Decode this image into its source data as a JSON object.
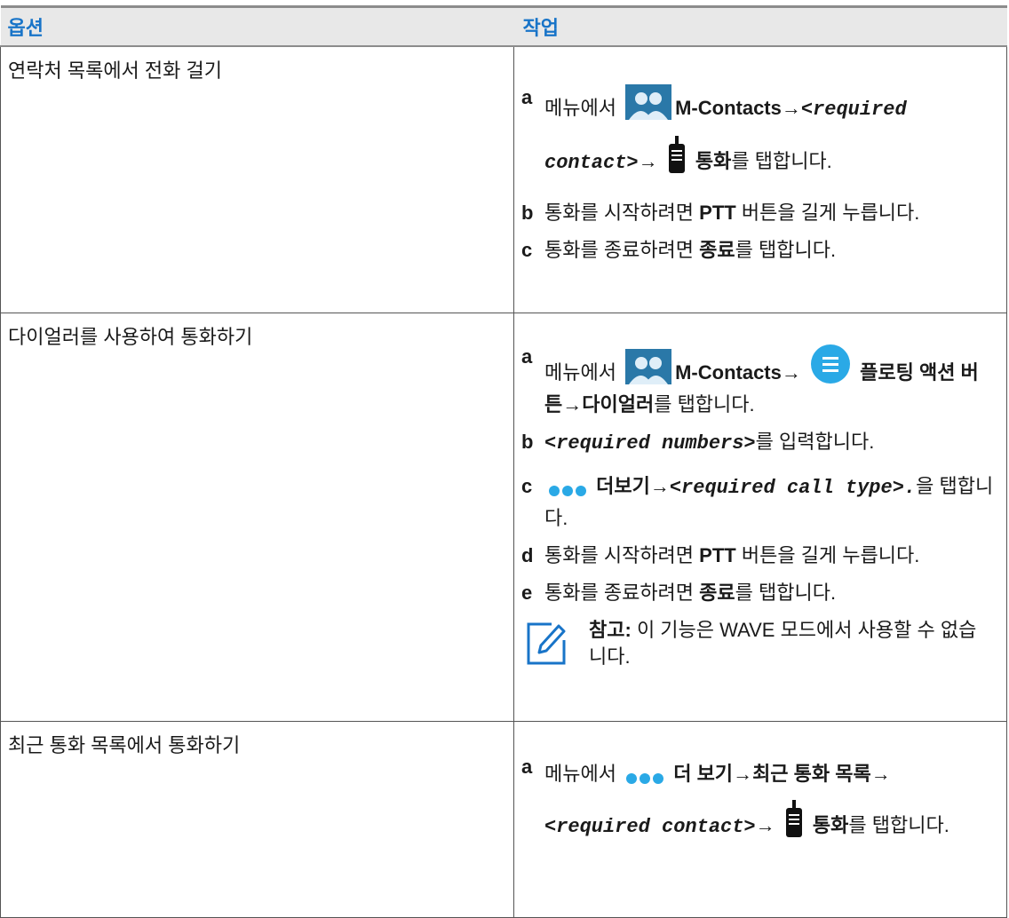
{
  "header": {
    "option": "옵션",
    "action": "작업"
  },
  "rows": [
    {
      "option": "연락처 목록에서 전화 걸기",
      "steps": {
        "a": {
          "letter": "a",
          "pre": "메뉴에서",
          "app": "M-Contacts",
          "arrow1": "→",
          "contact": "<required contact>",
          "arrow2": "→",
          "call": "통화",
          "post": "를 탭합니다.",
          "icon1": "contacts-app-icon",
          "icon2": "radio-call-icon"
        },
        "b": {
          "letter": "b",
          "pre": "통화를 시작하려면",
          "ptt": "PTT",
          "post": "버튼을 길게 누릅니다."
        },
        "c": {
          "letter": "c",
          "pre": "통화를 종료하려면",
          "end": "종료",
          "post": "를 탭합니다."
        }
      }
    },
    {
      "option": "다이얼러를 사용하여 통화하기",
      "steps": {
        "a": {
          "letter": "a",
          "pre": "메뉴에서",
          "app": "M-Contacts",
          "arrow1": "→",
          "fab": "플로팅 액션 버튼",
          "arrow2": "→",
          "dialer": "다이얼러",
          "post": "를 탭합니다.",
          "icon1": "contacts-app-icon",
          "icon2": "floating-action-menu-icon"
        },
        "b": {
          "letter": "b",
          "numbers": "<required numbers>",
          "post": "를 입력합니다."
        },
        "c": {
          "letter": "c",
          "more": "더보기",
          "arrow": "→",
          "calltype": "<required call type>.",
          "post": "을 탭합니다.",
          "icon": "more-dots-icon"
        },
        "d": {
          "letter": "d",
          "pre": "통화를 시작하려면",
          "ptt": "PTT",
          "post": "버튼을 길게 누릅니다."
        },
        "e": {
          "letter": "e",
          "pre": "통화를 종료하려면",
          "end": "종료",
          "post": "를 탭합니다."
        }
      },
      "note": {
        "label": "참고:",
        "text": "이 기능은 WAVE 모드에서 사용할 수 없습니다.",
        "icon": "note-pencil-icon"
      }
    },
    {
      "option": "최근 통화 목록에서 통화하기",
      "steps": {
        "a": {
          "letter": "a",
          "pre": "메뉴에서",
          "more": "더 보기",
          "arrow1": "→",
          "recent": "최근 통화 목록",
          "arrow2": "→",
          "contact": "<required contact>",
          "arrow3": "→",
          "call": "통화",
          "post": "를 탭합니다.",
          "icon1": "more-dots-icon",
          "icon2": "radio-call-icon"
        }
      }
    }
  ],
  "colors": {
    "header_text": "#1874c8",
    "header_bg": "#e8e8e8",
    "icon_blue": "#2aa9e6"
  }
}
